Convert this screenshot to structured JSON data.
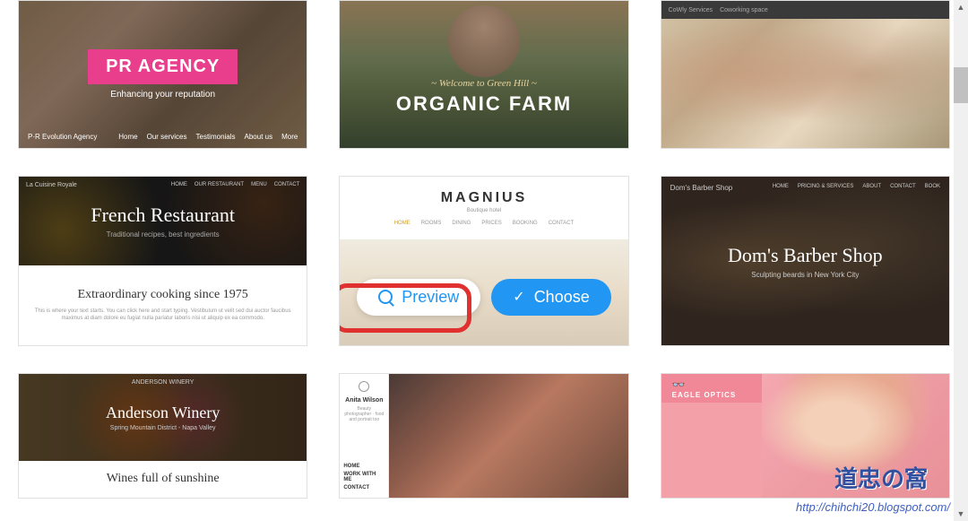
{
  "templates": {
    "pr_agency": {
      "title": "PR AGENCY",
      "subtitle": "Enhancing your reputation",
      "logo": "P·R Evolution Agency",
      "nav": [
        "Home",
        "Our services",
        "Testimonials",
        "About us",
        "More"
      ]
    },
    "organic_farm": {
      "welcome": "~ Welcome to Green Hill ~",
      "title": "ORGANIC FARM"
    },
    "coworking": {
      "topbar_items": [
        "CoWly Services",
        "Coworking space"
      ]
    },
    "french_restaurant": {
      "brand": "La Cuisine Royale",
      "nav": [
        "HOME",
        "OUR RESTAURANT",
        "MENU",
        "CONTACT"
      ],
      "title": "French Restaurant",
      "subtitle": "Traditional recipes, best ingredients",
      "headline": "Extraordinary cooking since 1975",
      "text": "This is where your text starts. You can click here and start typing. Vestibulum ut velit sed dui auctor faucibus maximus at diam dolore eu fugiat nulla pariatur laboris nisi ut aliquip ex ea commodo."
    },
    "magnius": {
      "logo": "MAGNIUS",
      "subtitle": "Boutique hotel",
      "nav": [
        "HOME",
        "ROOMS",
        "DINING",
        "PRICES",
        "BOOKING",
        "CONTACT"
      ]
    },
    "barber": {
      "brand": "Dom's Barber Shop",
      "nav": [
        "HOME",
        "PRICING & SERVICES",
        "ABOUT",
        "CONTACT",
        "BOOK"
      ],
      "title": "Dom's Barber Shop",
      "subtitle": "Sculpting beards in New York City"
    },
    "winery": {
      "brand": "ANDERSON WINERY",
      "title": "Anderson Winery",
      "subtitle": "Spring Mountain District - Napa Valley",
      "tagline": "Wines full of sunshine"
    },
    "anita": {
      "name": "Anita Wilson",
      "subtitle": "Beauty photographer · food and portrait too",
      "nav": [
        "HOME",
        "WORK WITH ME",
        "CONTACT"
      ]
    },
    "eagle": {
      "brand": "EAGLE OPTICS"
    }
  },
  "actions": {
    "preview": "Preview",
    "choose": "Choose"
  },
  "watermark": {
    "text": "道忠の窩",
    "url": "http://chihchi20.blogspot.com/"
  }
}
